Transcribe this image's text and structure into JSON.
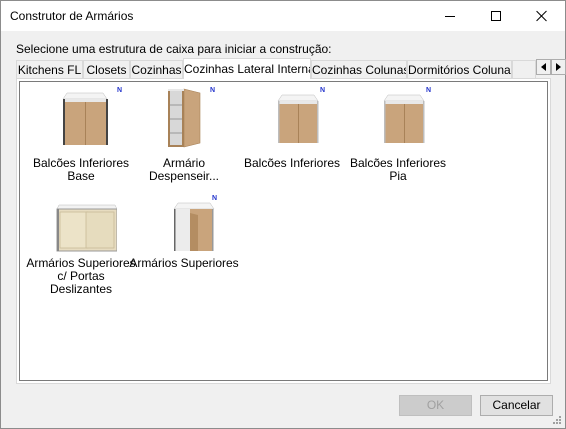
{
  "window": {
    "title": "Construtor de Armários"
  },
  "prompt": "Selecione uma estrutura de caixa para iniciar a construção:",
  "tabs": [
    {
      "label": "Kitchens FL",
      "active": false
    },
    {
      "label": "Closets",
      "active": false
    },
    {
      "label": "Cozinhas",
      "active": false
    },
    {
      "label": "Cozinhas Lateral Interna",
      "active": true
    },
    {
      "label": "Cozinhas Colunas",
      "active": false
    },
    {
      "label": "Dormitórios Colunas",
      "active": false
    }
  ],
  "items": [
    {
      "label": "Balcões Inferiores Base",
      "badge": "N",
      "icon": "base-cabinet-open-top-icon"
    },
    {
      "label": "Armário Despenseir...",
      "badge": "N",
      "icon": "pantry-cabinet-icon"
    },
    {
      "label": "Balcões Inferiores",
      "badge": "N",
      "icon": "base-cabinet-icon"
    },
    {
      "label": "Balcões Inferiores Pia",
      "badge": "N",
      "icon": "sink-base-cabinet-icon"
    },
    {
      "label": "Armários Superiores c/ Portas Deslizantes",
      "badge": "",
      "icon": "sliding-door-wall-cabinet-icon"
    },
    {
      "label": "Armários Superiores",
      "badge": "N",
      "icon": "wall-cabinet-icon"
    }
  ],
  "buttons": {
    "ok": "OK",
    "cancel": "Cancelar"
  },
  "colors": {
    "wood": "#c9a47c",
    "wood_dark": "#a88258",
    "panel_white": "#e8e8e8",
    "badge": "#2233cc"
  }
}
